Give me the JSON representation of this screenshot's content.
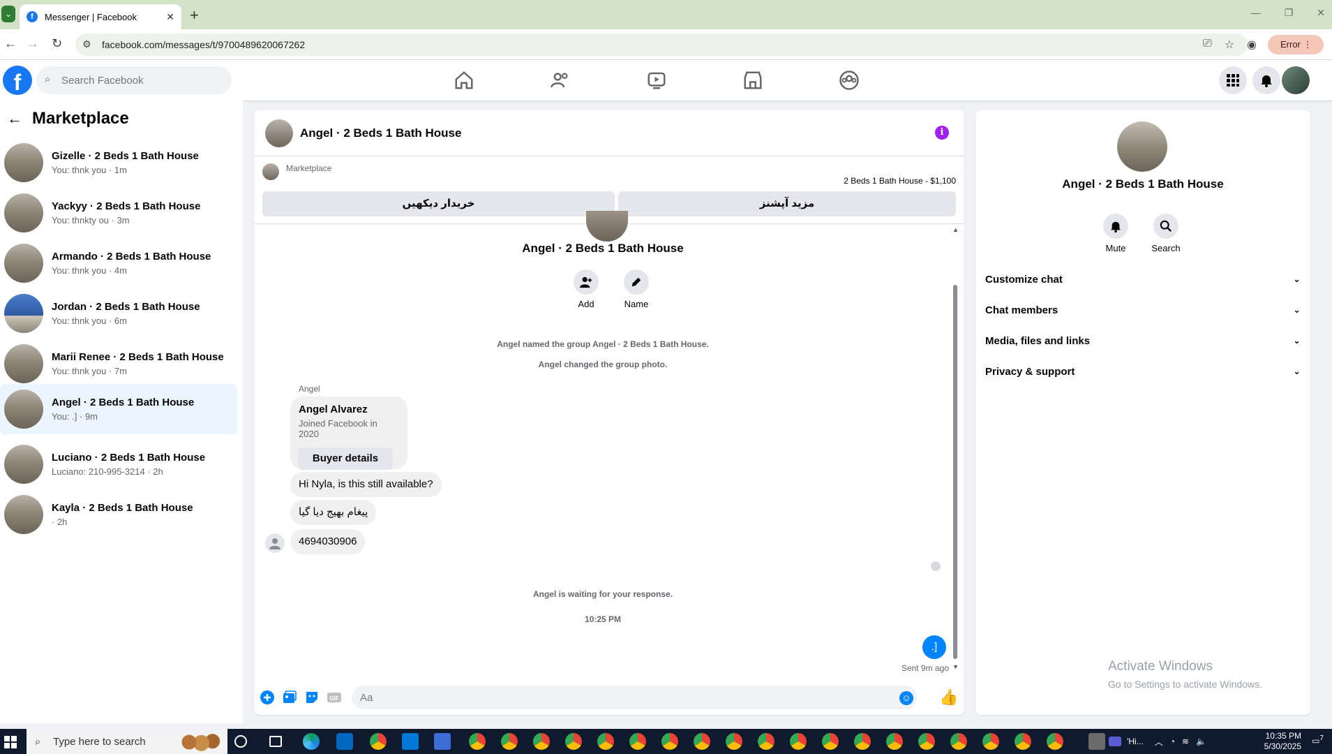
{
  "browser": {
    "tab_title": "Messenger | Facebook",
    "url": "facebook.com/messages/t/9700489620067262",
    "status_pill": "Error"
  },
  "fbnav": {
    "search_placeholder": "Search Facebook"
  },
  "sidebar": {
    "title": "Marketplace",
    "conversations": [
      {
        "name": "Gizelle · 2 Beds 1 Bath House",
        "snippet": "You: thnk you · 1m"
      },
      {
        "name": "Yackyy · 2 Beds 1 Bath House",
        "snippet": "You: thnkty ou · 3m"
      },
      {
        "name": "Armando · 2 Beds 1 Bath House",
        "snippet": "You: thnk you · 4m"
      },
      {
        "name": "Jordan · 2 Beds 1 Bath House",
        "snippet": "You: thnk you · 6m"
      },
      {
        "name": "Marii Renee · 2 Beds 1 Bath House",
        "snippet": "You: thnk you · 7m"
      },
      {
        "name": "Angel · 2 Beds 1 Bath House",
        "snippet": "You: .] · 9m"
      },
      {
        "name": "Luciano · 2 Beds 1 Bath House",
        "snippet": "Luciano: 210-995-3214 · 2h"
      },
      {
        "name": "Kayla · 2 Beds 1 Bath House",
        "snippet": " · 2h"
      }
    ]
  },
  "chat": {
    "header_name": "Angel · 2 Beds 1 Bath House",
    "marketplace_label": "Marketplace",
    "listing_price": "2 Beds 1 Bath House - $1,100",
    "btn_view_buyer": "خریدار دیکھیں",
    "btn_more_options": "مزید آپشنز",
    "group_name": "Angel · 2 Beds 1 Bath House",
    "action_add": "Add",
    "action_name": "Name",
    "sys_named": "Angel named the group Angel · 2 Beds 1 Bath House.",
    "sys_photo": "Angel changed the group photo.",
    "sender": "Angel",
    "card_name": "Angel Alvarez",
    "card_sub": "Joined Facebook in 2020",
    "card_btn": "Buyer details",
    "msg1": "Hi Nyla, is this still available?",
    "msg2": "پیغام بھیج دیا گیا",
    "msg3": "4694030906",
    "waiting": "Angel is waiting for your response.",
    "time": "10:25 PM",
    "out_msg": ".]",
    "sent": "Sent 9m ago",
    "composer_placeholder": "Aa"
  },
  "rpanel": {
    "name": "Angel · 2 Beds 1 Bath House",
    "mute": "Mute",
    "search": "Search",
    "rows": [
      "Customize chat",
      "Chat members",
      "Media, files and links",
      "Privacy & support"
    ]
  },
  "watermark": {
    "line1": "Activate Windows",
    "line2": "Go to Settings to activate Windows."
  },
  "taskbar": {
    "search_placeholder": "Type here to search",
    "tray_text": "'Hi...",
    "time": "10:35 PM",
    "date": "5/30/2025",
    "notif_count": "7"
  },
  "colors": {
    "fb_blue": "#1877f2",
    "messenger_blue": "#0084ff",
    "info_purple": "#a020f0"
  }
}
